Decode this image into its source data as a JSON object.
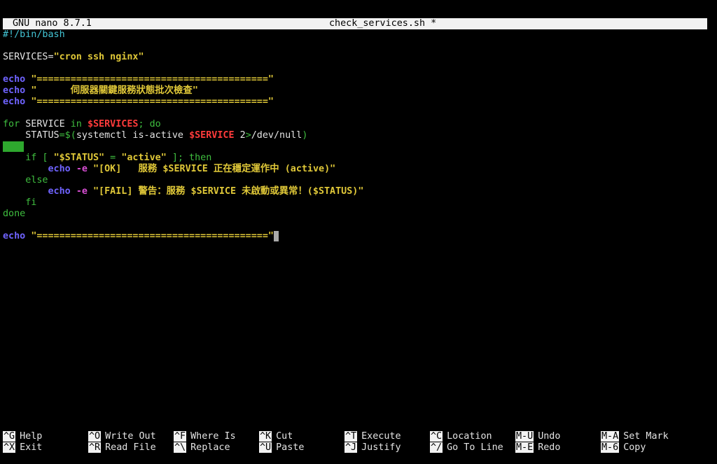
{
  "title_bar": {
    "app_name": "GNU nano 8.7.1",
    "file_name": "check_services.sh *"
  },
  "code": {
    "shebang": "#!/bin/bash",
    "services_assign": "SERVICES=",
    "services_value": "\"cron ssh nginx\"",
    "echo_kw": "echo",
    "separator": "\"=========================================\"",
    "banner_text": "\"      伺服器關鍵服務狀態批次檢查\"",
    "for_kw": "for",
    "service_var": " SERVICE ",
    "in_kw": "in",
    "services_ref": "$SERVICES",
    "do_kw": "; do",
    "status_assign": "    STATUS",
    "status_eq": "=$(",
    "systemctl_cmd": "systemctl is-active ",
    "service_ref": "$SERVICE",
    "redirect_num": " 2",
    "redirect_op": ">",
    "devnull": "/dev/null",
    "close_paren": ")",
    "if_open": "    if [ ",
    "status_str": "\"$STATUS\"",
    "eq_op": " = ",
    "active_str": "\"active\"",
    "then_part": " ]; then",
    "indent_echo": "        ",
    "e_flag": "-e",
    "ok_msg": "\"[OK]   服務 $SERVICE 正在穩定運作中 (active)\"",
    "else_kw": "    else",
    "fail_msg": "\"[FAIL] 警告：服務 $SERVICE 未啟動或異常！($STATUS)\"",
    "fi_kw": "    fi",
    "done_kw": "done"
  },
  "shortcuts": [
    {
      "key": "^G",
      "label": "Help"
    },
    {
      "key": "^X",
      "label": "Exit"
    },
    {
      "key": "^O",
      "label": "Write Out"
    },
    {
      "key": "^R",
      "label": "Read File"
    },
    {
      "key": "^F",
      "label": "Where Is"
    },
    {
      "key": "^\\",
      "label": "Replace"
    },
    {
      "key": "^K",
      "label": "Cut"
    },
    {
      "key": "^U",
      "label": "Paste"
    },
    {
      "key": "^T",
      "label": "Execute"
    },
    {
      "key": "^J",
      "label": "Justify"
    },
    {
      "key": "^C",
      "label": "Location"
    },
    {
      "key": "^/",
      "label": "Go To Line"
    },
    {
      "key": "M-U",
      "label": "Undo"
    },
    {
      "key": "M-E",
      "label": "Redo"
    },
    {
      "key": "M-A",
      "label": "Set Mark"
    },
    {
      "key": "M-6",
      "label": "Copy"
    }
  ],
  "colors": {
    "echo_keyword": "#6f63ff",
    "string": "#e0c838",
    "variable": "#ff3b3b",
    "control_keyword": "#3fbe3f",
    "flag": "#d94fd4",
    "shebang": "#43c6d6"
  }
}
